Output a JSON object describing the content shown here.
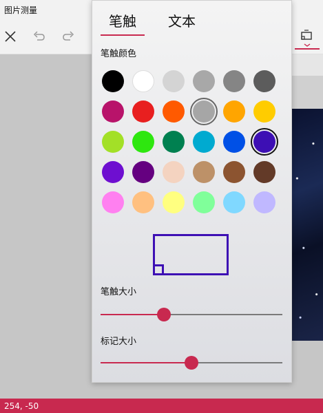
{
  "app": {
    "title": "图片测量"
  },
  "toolbar": {
    "close_icon": "close-icon",
    "undo_icon": "undo-icon",
    "redo_icon": "redo-icon",
    "mark_icon": "markup-tool-icon",
    "accent": "#c8294f"
  },
  "panel": {
    "tabs": [
      {
        "label": "笔触",
        "active": true
      },
      {
        "label": "文本",
        "active": false
      }
    ],
    "stroke_color_label": "笔触颜色",
    "palette": [
      "#000000",
      "#ffffff",
      "#d4d4d4",
      "#a8a8a8",
      "#858585",
      "#5c5c5c",
      "#b8136a",
      "#e81f1f",
      "#ff5a00",
      "#a6a6a6",
      "#ffa500",
      "#ffcc00",
      "#a3e027",
      "#2ee70f",
      "#008050",
      "#00aad0",
      "#0050e6",
      "#3d0fb4",
      "#6e0fd0",
      "#650080",
      "#f4d3c0",
      "#bd9168",
      "#8c5430",
      "#633a28",
      "#ff80f0",
      "#ffc080",
      "#ffff80",
      "#80ff9a",
      "#80d8ff",
      "#c0b8ff"
    ],
    "selected_color_index": 17,
    "highlighted_color_index": 9,
    "stroke_size_label": "笔触大小",
    "stroke_size_value": 0.35,
    "mark_size_label": "标记大小",
    "mark_size_value": 0.5
  },
  "status": {
    "coords": "254, -50"
  }
}
